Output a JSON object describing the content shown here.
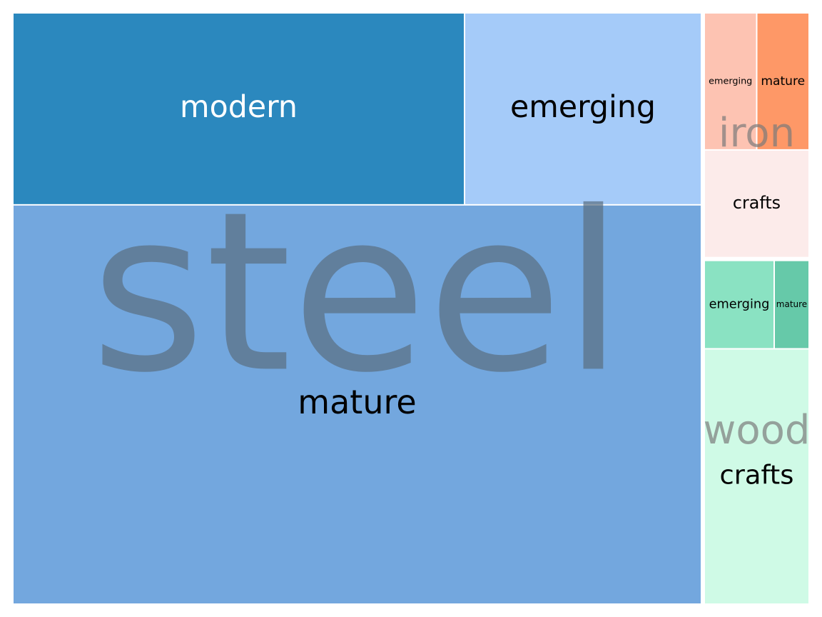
{
  "chart_data": {
    "type": "treemap",
    "groups": [
      {
        "name": "steel",
        "label_color": "#5a6e80",
        "children": [
          {
            "name": "modern",
            "value": 164,
            "color": "#2b88be",
            "text_color": "#ffffff"
          },
          {
            "name": "emerging",
            "value": 86,
            "color": "#a5cbf9",
            "text_color": "#000000"
          },
          {
            "name": "mature",
            "value": 520,
            "color": "#73a7de",
            "text_color": "#000000"
          }
        ]
      },
      {
        "name": "iron",
        "label_color": "#7a7a7a",
        "children": [
          {
            "name": "emerging",
            "value": 14,
            "color": "#fdc3b2",
            "text_color": "#000000"
          },
          {
            "name": "mature",
            "value": 14,
            "color": "#fe9867",
            "text_color": "#000000"
          },
          {
            "name": "crafts",
            "value": 22,
            "color": "#fcebea",
            "text_color": "#000000"
          }
        ]
      },
      {
        "name": "wood",
        "label_color": "#7a7a7a",
        "children": [
          {
            "name": "emerging",
            "value": 12,
            "color": "#8ae2c2",
            "text_color": "#000000"
          },
          {
            "name": "mature",
            "value": 6,
            "color": "#66c9a9",
            "text_color": "#000000"
          },
          {
            "name": "crafts",
            "value": 52,
            "color": "#cffae6",
            "text_color": "#000000"
          }
        ]
      }
    ]
  }
}
